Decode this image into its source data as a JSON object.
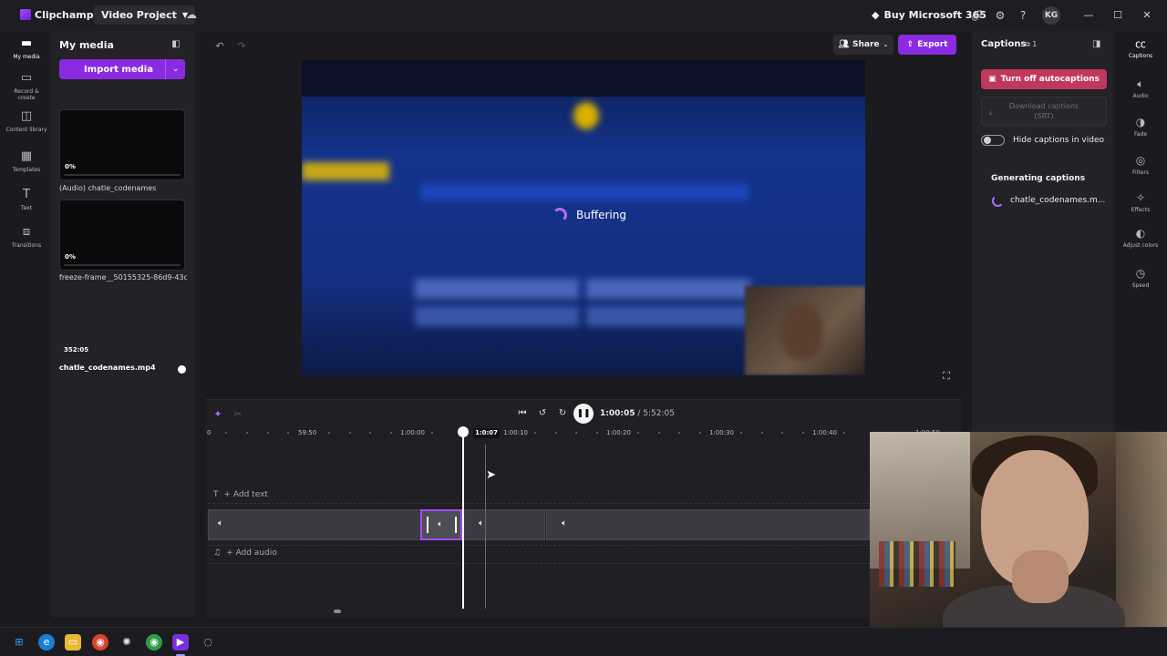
{
  "titlebar": {
    "app_name": "Clipchamp",
    "project_name": "Video Project",
    "project_caret": "▼",
    "buy_label": "Buy Microsoft 365",
    "avatar_initials": "KG"
  },
  "left_rail": {
    "items": [
      {
        "label": "My media",
        "icon": "folder-icon"
      },
      {
        "label": "Record & create",
        "icon": "camera-icon"
      },
      {
        "label": "Content library",
        "icon": "library-icon"
      },
      {
        "label": "Templates",
        "icon": "templates-icon"
      },
      {
        "label": "Text",
        "icon": "text-icon"
      },
      {
        "label": "Transitions",
        "icon": "transitions-icon"
      }
    ]
  },
  "media_panel": {
    "title": "My media",
    "import_label": "Import media",
    "items": [
      {
        "name": "(Audio) chatle_codenames",
        "progress": "0%"
      },
      {
        "name": "freeze-frame__50155325-86d9-43c6-...",
        "progress": "0%"
      },
      {
        "name": "chatle_codenames.mp4",
        "duration": "352:05"
      }
    ]
  },
  "toolbar": {
    "share_label": "Share",
    "export_label": "Export"
  },
  "preview": {
    "status": "Buffering"
  },
  "playback": {
    "current_time": "1:00:05",
    "separator": " / ",
    "total_time": "5:52:05"
  },
  "timeline": {
    "playhead_time": "1:0:07",
    "ruler_labels": [
      "0",
      "59:50",
      "1:00:00",
      "1:00:10",
      "1:00:20",
      "1:00:30",
      "1:00:40",
      "1:00:50"
    ],
    "add_text_label": "+ Add text",
    "add_audio_label": "+ Add audio"
  },
  "captions_panel": {
    "title": "Captions",
    "count": "1",
    "turn_off_label": "Turn off autocaptions",
    "download_label": "Download captions",
    "download_sub": "(SRT)",
    "hide_label": "Hide captions in video",
    "hide_enabled": false,
    "generating_title": "Generating captions",
    "generating_file": "chatle_codenames.m..."
  },
  "right_rail": {
    "items": [
      {
        "label": "Captions",
        "icon": "captions-icon"
      },
      {
        "label": "Audio",
        "icon": "speaker-icon"
      },
      {
        "label": "Fade",
        "icon": "fade-icon"
      },
      {
        "label": "Filters",
        "icon": "filters-icon"
      },
      {
        "label": "Effects",
        "icon": "effects-icon"
      },
      {
        "label": "Adjust colors",
        "icon": "adjust-colors-icon"
      },
      {
        "label": "Speed",
        "icon": "speed-icon"
      }
    ]
  },
  "colors": {
    "accent": "#8a2be2",
    "danger": "#c0385a",
    "panel": "#222227"
  }
}
